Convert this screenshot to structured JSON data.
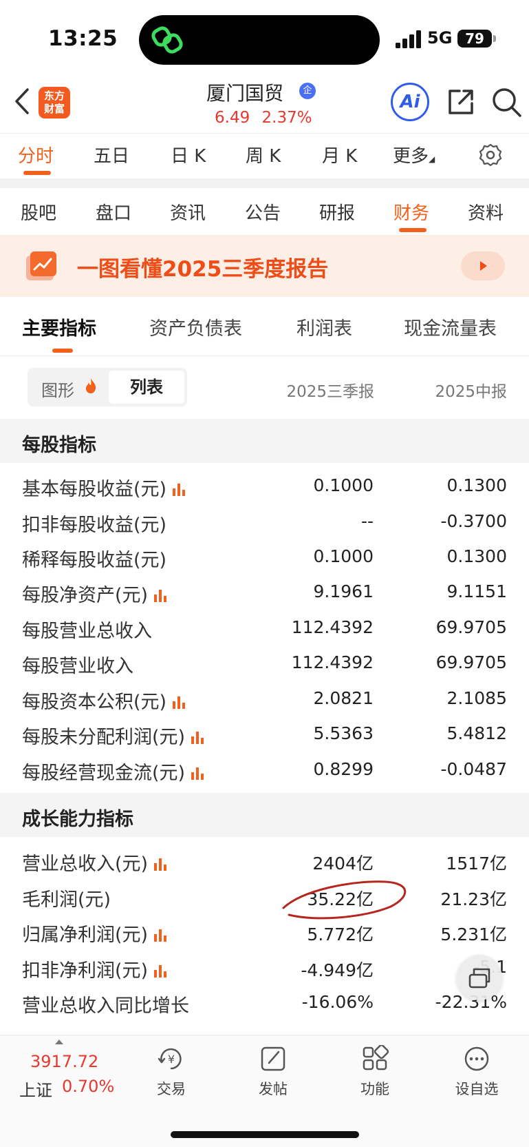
{
  "status": {
    "time": "13:25",
    "network": "5G",
    "battery": "79"
  },
  "header": {
    "logo_line1": "东方",
    "logo_line2": "财富",
    "stock_name": "厦门国贸",
    "badge": "企",
    "price": "6.49",
    "change_pct": "2.37%",
    "ai_label": "Ai"
  },
  "chart_tabs": [
    "分时",
    "五日",
    "日 K",
    "周 K",
    "月 K",
    "更多"
  ],
  "section_tabs": [
    "股吧",
    "盘口",
    "资讯",
    "公告",
    "研报",
    "财务",
    "资料"
  ],
  "banner": {
    "text": "一图看懂2025三季度报告"
  },
  "statement_tabs": [
    "主要指标",
    "资产负债表",
    "利润表",
    "现金流量表"
  ],
  "toggle": {
    "chart": "图形",
    "list": "列表"
  },
  "columns": [
    "2025三季报",
    "2025中报"
  ],
  "groups": [
    {
      "title": "每股指标",
      "rows": [
        {
          "label": "基本每股收益(元)",
          "v1": "0.1000",
          "v2": "0.1300"
        },
        {
          "label": "扣非每股收益(元)",
          "v1": "--",
          "v2": "-0.3700"
        },
        {
          "label": "稀释每股收益(元)",
          "v1": "0.1000",
          "v2": "0.1300"
        },
        {
          "label": "每股净资产(元)",
          "v1": "9.1961",
          "v2": "9.1151"
        },
        {
          "label": "每股营业总收入",
          "v1": "112.4392",
          "v2": "69.9705"
        },
        {
          "label": "每股营业收入",
          "v1": "112.4392",
          "v2": "69.9705"
        },
        {
          "label": "每股资本公积(元)",
          "v1": "2.0821",
          "v2": "2.1085"
        },
        {
          "label": "每股未分配利润(元)",
          "v1": "5.5363",
          "v2": "5.4812"
        },
        {
          "label": "每股经营现金流(元)",
          "v1": "0.8299",
          "v2": "-0.0487"
        }
      ]
    },
    {
      "title": "成长能力指标",
      "rows": [
        {
          "label": "营业总收入(元)",
          "v1": "2404亿",
          "v2": "1517亿"
        },
        {
          "label": "毛利润(元)",
          "v1": "35.22亿",
          "v2": "21.23亿"
        },
        {
          "label": "归属净利润(元)",
          "v1": "5.772亿",
          "v2": "5.231亿"
        },
        {
          "label": "扣非净利润(元)",
          "v1": "-4.949亿",
          "v2": "-5.1"
        },
        {
          "label": "营业总收入同比增长",
          "v1": "-16.06%",
          "v2": "-22.31%"
        }
      ]
    }
  ],
  "bottom_nav": {
    "index_value": "3917.72",
    "index_name": "上证",
    "index_change": "0.70%",
    "items": [
      "交易",
      "发帖",
      "功能",
      "设自选"
    ]
  },
  "colors": {
    "accent": "#f1611c",
    "up_red": "#e8382e",
    "ai_blue": "#2f5ce8"
  }
}
